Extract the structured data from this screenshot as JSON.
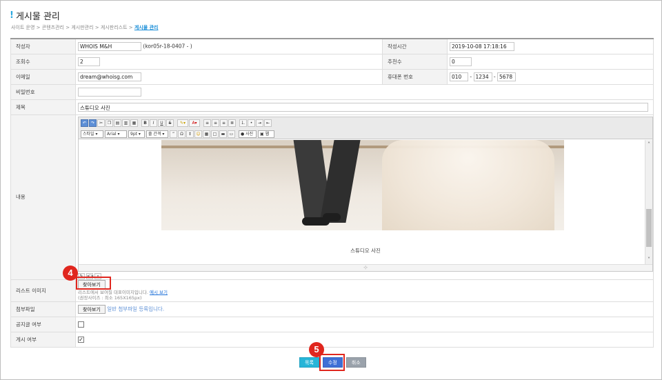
{
  "page": {
    "title": "게시물 관리",
    "breadcrumb": [
      "사이트 운영",
      "콘텐츠관리",
      "게시판관리",
      "게시판리스트"
    ],
    "breadcrumb_current": "게시물 관리",
    "breadcrumb_sep": ">"
  },
  "form": {
    "author_label": "작성자",
    "author_value": "WHOIS M&H",
    "author_id": "(kor05r-18-0407 - )",
    "created_label": "작성시간",
    "created_value": "2019-10-08 17:18:16",
    "views_label": "조회수",
    "views_value": "2",
    "recommend_label": "추천수",
    "recommend_value": "0",
    "email_label": "이메일",
    "email_value": "dream@whoisg.com",
    "phone_label": "휴대폰 번호",
    "phone_1": "010",
    "phone_2": "1234",
    "phone_3": "5678",
    "phone_dash": "-",
    "password_label": "비밀번호",
    "password_value": "",
    "subject_label": "제목",
    "subject_value": "스튜디오 사진",
    "content_label": "내용",
    "list_image_label": "리스트 이미지",
    "find_button": "찾아보기",
    "list_image_hint_1": "리스트에서 보여질 대표이미지입니다.",
    "list_image_hint_link": "예시 보기",
    "list_image_hint_2": "(권장사이즈 : 최소 165X165px)",
    "attachment_label": "첨부파일",
    "attachment_find_button": "찾아보기",
    "attachment_hint": "일반 첨부파일 등록입니다.",
    "notice_label": "공지글 여부",
    "notice_checked": false,
    "publish_label": "게시 여부",
    "publish_checked": true
  },
  "editor": {
    "row1_icons": [
      "undo-icon",
      "redo-icon",
      "cut-icon",
      "copy-icon",
      "paste-icon",
      "paste-text-icon",
      "paste-word-icon"
    ],
    "bold": "B",
    "italic": "I",
    "underline": "U",
    "strike": "S",
    "style_select": "스타일",
    "font_select": "Arial",
    "size_select": "9pt",
    "line_height_select": "줄 간격",
    "quote_glyph": "“",
    "omega_glyph": "Ω",
    "photo_button": "사진",
    "web_button": "웹",
    "caption": "스튜디오 사진"
  },
  "buttons": {
    "list": "목록",
    "modify": "수정",
    "cancel": "취소"
  },
  "annotations": {
    "step4": "4",
    "step5": "5"
  },
  "colors": {
    "accent": "#29a8e0",
    "list_button": "#27b5d8",
    "modify_button": "#3f6fd6",
    "cancel_button": "#9aa2ab",
    "highlight": "#e0261e"
  }
}
